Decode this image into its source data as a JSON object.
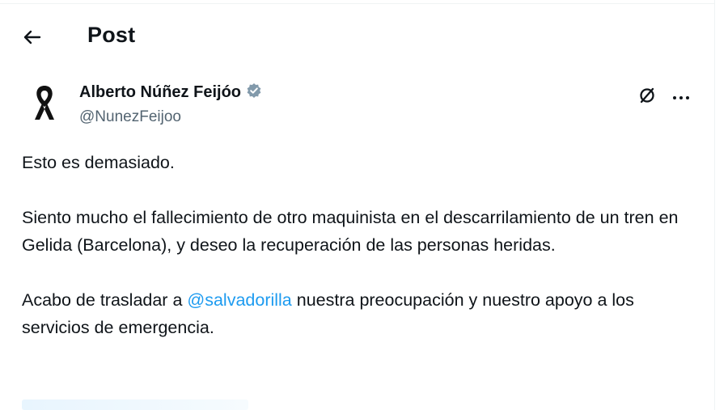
{
  "header": {
    "title": "Post",
    "back_icon": "arrow-left-icon"
  },
  "author": {
    "name": "Alberto Núñez Feijóo",
    "handle": "@NunezFeijoo",
    "verified": true,
    "verified_color": "#829aab",
    "avatar_icon": "mourning-ribbon-icon"
  },
  "actions": {
    "grok_icon": "grok-icon",
    "more_icon": "more-horizontal-icon"
  },
  "tweet": {
    "line1": "Esto es demasiado.",
    "line2": "Siento mucho el fallecimiento de otro maquinista en el descarrilamiento de un tren en Gelida (Barcelona), y deseo la recuperación de las personas heridas.",
    "line3_before": "Acabo de trasladar a ",
    "mention": "@salvadorilla",
    "line3_after": " nuestra preocupación y nuestro apoyo a los servicios de emergencia."
  },
  "colors": {
    "text": "#0f1419",
    "secondary": "#536471",
    "link": "#1d9bf0"
  }
}
